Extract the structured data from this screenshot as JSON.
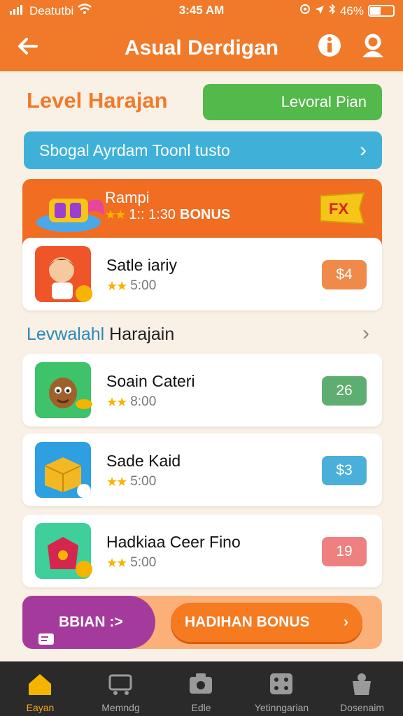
{
  "status_bar": {
    "carrier": "Deatutbi",
    "time": "3:45 AM",
    "battery_pct": "46%",
    "battery_level": 0.46
  },
  "header": {
    "back_icon": "arrow-left-icon",
    "title": "Asual Derdigan",
    "info_icon": "info-icon",
    "profile_icon": "user-icon"
  },
  "level": {
    "title": "Level Harajan",
    "button_label": "Levoral Pian"
  },
  "banner": {
    "text": "Sbogal Ayrdam Toonl tusto"
  },
  "promo": {
    "name": "Rampi",
    "count": "1:: 1:30",
    "bonus_label": "BONUS",
    "tag_text": "FX"
  },
  "featured_item": {
    "name": "Satle iariy",
    "rating_value": "5:00",
    "price": "$4",
    "price_color": "#f08a4a"
  },
  "section": {
    "title_part1": "Levwalahl",
    "title_part2": " Harajain"
  },
  "items": [
    {
      "name": "Soain Cateri",
      "rating_value": "8:00",
      "price": "26",
      "price_color": "#5fae71"
    },
    {
      "name": "Sade Kaid",
      "rating_value": "5:00",
      "price": "$3",
      "price_color": "#4ab0d9"
    },
    {
      "name": "Hadkiaa Ceer Fino",
      "rating_value": "5:00",
      "price": "19",
      "price_color": "#ee8080"
    }
  ],
  "action_bar": {
    "left_label": "BBIAN :>",
    "bonus_label": "HADIHAN BONUS"
  },
  "tabs": [
    {
      "label": "Eayan",
      "icon": "home-icon",
      "active": true
    },
    {
      "label": "Memndg",
      "icon": "cart-icon",
      "active": false
    },
    {
      "label": "Edle",
      "icon": "camera-icon",
      "active": false
    },
    {
      "label": "Yetinngarian",
      "icon": "grid-icon",
      "active": false
    },
    {
      "label": "Dosenaim",
      "icon": "bag-icon",
      "active": false
    }
  ],
  "colors": {
    "brand_orange": "#f07a2a",
    "green": "#53b94a",
    "blue": "#3fb1d8",
    "purple": "#a43b9c"
  }
}
